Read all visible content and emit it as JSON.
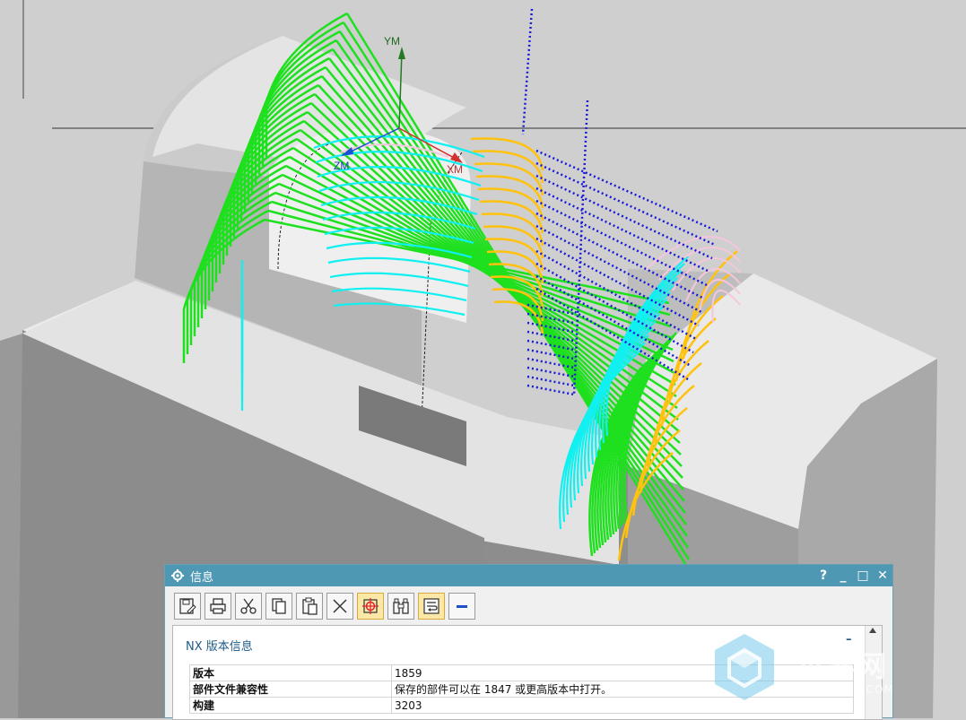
{
  "viewport": {
    "axes": {
      "y_label": "YM",
      "z_label": "ZM",
      "x_label": "XM"
    }
  },
  "info_window": {
    "title": "信息",
    "controls": {
      "help": "?",
      "minimize": "_",
      "maximize": "□",
      "close": "✕"
    },
    "toolbar": [
      "save-icon",
      "print-icon",
      "cut-icon",
      "copy-icon",
      "paste-icon",
      "delete-icon",
      "target-icon",
      "find-icon",
      "wrap-icon",
      "collapse-icon"
    ],
    "section_title": "NX 版本信息",
    "collapse_symbol": "–",
    "rows": [
      {
        "key": "版本",
        "value": "1859"
      },
      {
        "key": "部件文件兼容性",
        "value": "保存的部件可以在 1847 或更高版本中打开。"
      },
      {
        "key": "构建",
        "value": "3203"
      }
    ]
  },
  "watermark": {
    "text": "世界网",
    "sub": "SJV.COM"
  },
  "colors": {
    "title_bar": "#4f98b3",
    "green_path": "#1ee01e",
    "cyan_path": "#10f0f0",
    "orange_path": "#ffc20e",
    "blue_dotted": "#1a1ad8"
  }
}
